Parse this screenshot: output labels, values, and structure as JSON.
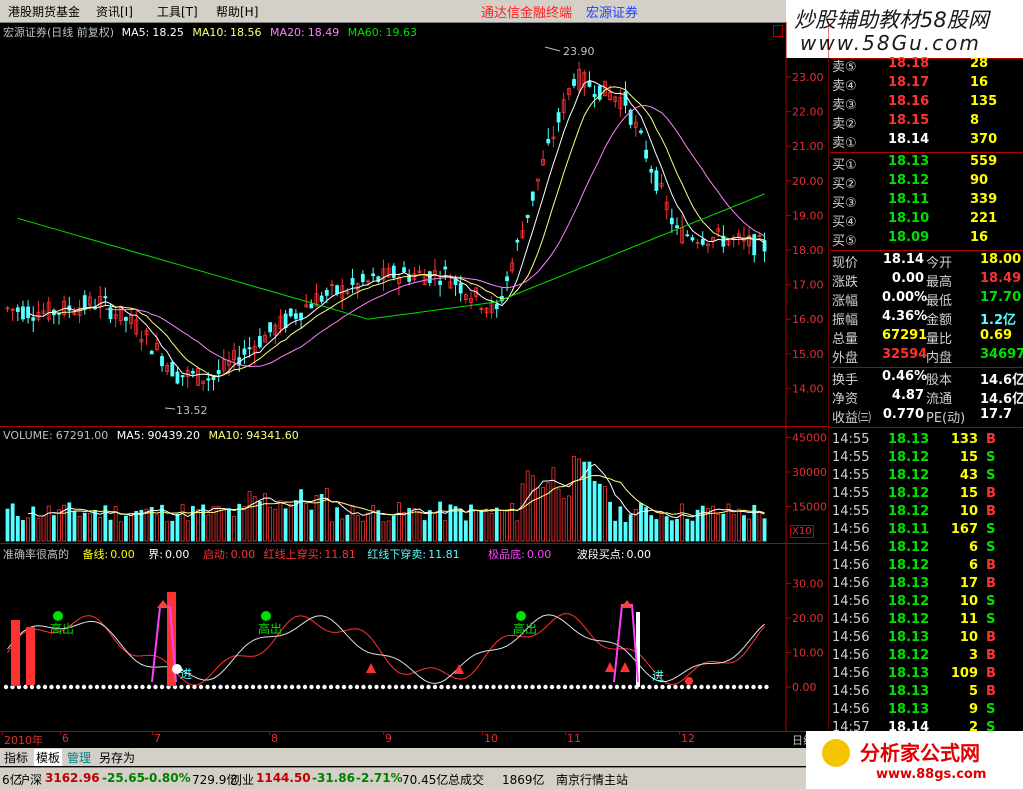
{
  "menu": {
    "items": [
      "港股期货基金",
      "资讯[I]",
      "工具[T]",
      "帮助[H]"
    ],
    "brand_red": "通达信金融终端",
    "brand_blue": "宏源证券"
  },
  "watermark": {
    "text": "炒股辅助教材58股网",
    "url": "www.58Gu.com"
  },
  "price_panel": {
    "title": "宏源证券(日线 前复权)",
    "ma5_label": "MA5:",
    "ma5": "18.25",
    "ma10_label": "MA10:",
    "ma10": "18.56",
    "ma20_label": "MA20:",
    "ma20": "18.49",
    "ma60_label": "MA60:",
    "ma60": "19.63",
    "y_ticks": [
      "23.00",
      "22.00",
      "21.00",
      "20.00",
      "19.00",
      "18.00",
      "17.00",
      "16.00",
      "15.00",
      "14.00"
    ],
    "high_marker": "23.90",
    "low_marker": "13.52"
  },
  "volume_panel": {
    "volume_label": "VOLUME:",
    "volume": "67291.00",
    "ma5_label": "MA5:",
    "ma5": "90439.20",
    "ma10_label": "MA10:",
    "ma10": "94341.60",
    "y_ticks": [
      "45000",
      "30000",
      "15000"
    ],
    "unit": "X10"
  },
  "indicator_panel": {
    "name": "准确率很高的",
    "beixian_label": "备线:",
    "beixian": "0.00",
    "jie_label": "界:",
    "jie": "0.00",
    "qidong_label": "启动:",
    "qidong": "0.00",
    "hongshang_label": "红线上穿买:",
    "hongshang": "11.81",
    "hongxia_label": "红线下穿卖:",
    "hongxia": "11.81",
    "jidi_label": "极品底:",
    "jidi": "0.00",
    "boduan_label": "波段买点:",
    "boduan": "0.00",
    "y_ticks": [
      "30.00",
      "20.00",
      "10.00",
      "0.00"
    ],
    "chu_label": "高出",
    "jin_label": "进"
  },
  "x_axis": {
    "labels": [
      "2010年",
      "6",
      "7",
      "8",
      "9",
      "10",
      "11",
      "12"
    ],
    "period": "日线"
  },
  "order_book": {
    "asks": [
      {
        "label": "卖⑤",
        "price": "18.18",
        "vol": "28"
      },
      {
        "label": "卖④",
        "price": "18.17",
        "vol": "16"
      },
      {
        "label": "卖③",
        "price": "18.16",
        "vol": "135"
      },
      {
        "label": "卖②",
        "price": "18.15",
        "vol": "8"
      },
      {
        "label": "卖①",
        "price": "18.14",
        "vol": "370"
      }
    ],
    "bids": [
      {
        "label": "买①",
        "price": "18.13",
        "vol": "559"
      },
      {
        "label": "买②",
        "price": "18.12",
        "vol": "90"
      },
      {
        "label": "买③",
        "price": "18.11",
        "vol": "339"
      },
      {
        "label": "买④",
        "price": "18.10",
        "vol": "221"
      },
      {
        "label": "买⑤",
        "price": "18.09",
        "vol": "16"
      }
    ]
  },
  "quote": [
    {
      "l1": "现价",
      "v1": "18.14",
      "l2": "今开",
      "v2": "18.00"
    },
    {
      "l1": "涨跌",
      "v1": "0.00",
      "l2": "最高",
      "v2": "18.49"
    },
    {
      "l1": "涨幅",
      "v1": "0.00%",
      "l2": "最低",
      "v2": "17.70"
    },
    {
      "l1": "振幅",
      "v1": "4.36%",
      "l2": "金额",
      "v2": "1.2亿"
    },
    {
      "l1": "总量",
      "v1": "67291",
      "l2": "量比",
      "v2": "0.69"
    },
    {
      "l1": "外盘",
      "v1": "32594",
      "l2": "内盘",
      "v2": "34697"
    },
    {
      "l1": "换手",
      "v1": "0.46%",
      "l2": "股本",
      "v2": "14.6亿"
    },
    {
      "l1": "净资",
      "v1": "4.87",
      "l2": "流通",
      "v2": "14.6亿"
    },
    {
      "l1": "收益㈢",
      "v1": "0.770",
      "l2": "PE(动)",
      "v2": "17.7"
    }
  ],
  "ticks": [
    {
      "t": "14:55",
      "p": "18.13",
      "v": "133",
      "s": "B"
    },
    {
      "t": "14:55",
      "p": "18.12",
      "v": "15",
      "s": "S"
    },
    {
      "t": "14:55",
      "p": "18.12",
      "v": "43",
      "s": "S"
    },
    {
      "t": "14:55",
      "p": "18.12",
      "v": "15",
      "s": "B"
    },
    {
      "t": "14:55",
      "p": "18.12",
      "v": "10",
      "s": "B"
    },
    {
      "t": "14:56",
      "p": "18.11",
      "v": "167",
      "s": "S"
    },
    {
      "t": "14:56",
      "p": "18.12",
      "v": "6",
      "s": "S"
    },
    {
      "t": "14:56",
      "p": "18.12",
      "v": "6",
      "s": "B"
    },
    {
      "t": "14:56",
      "p": "18.13",
      "v": "17",
      "s": "B"
    },
    {
      "t": "14:56",
      "p": "18.12",
      "v": "10",
      "s": "S"
    },
    {
      "t": "14:56",
      "p": "18.12",
      "v": "11",
      "s": "S"
    },
    {
      "t": "14:56",
      "p": "18.13",
      "v": "10",
      "s": "B"
    },
    {
      "t": "14:56",
      "p": "18.12",
      "v": "3",
      "s": "B"
    },
    {
      "t": "14:56",
      "p": "18.13",
      "v": "109",
      "s": "B"
    },
    {
      "t": "14:56",
      "p": "18.13",
      "v": "5",
      "s": "B"
    },
    {
      "t": "14:56",
      "p": "18.13",
      "v": "9",
      "s": "S"
    },
    {
      "t": "14:57",
      "p": "18.14",
      "v": "2",
      "s": "S"
    }
  ],
  "tabs": [
    "指标",
    "模板",
    "管理",
    "另存为"
  ],
  "status": {
    "s1": "6亿",
    "s2": "沪深",
    "s3": "3162.96",
    "s4": "-25.65",
    "s5": "-0.80%",
    "s6": "729.9亿",
    "s7": "创业",
    "s8": "1144.50",
    "s9": "-31.86",
    "s10": "-2.71%",
    "s11": "70.45亿",
    "s12": "总成交",
    "s13": "1869亿",
    "s14": "南京行情主站"
  },
  "logo2": {
    "text": "分析家公式网",
    "url": "www.88gs.com"
  },
  "colors": {
    "up": "#ff3232",
    "down": "#54ffff",
    "ma5": "#ffffff",
    "ma10": "#ffff80",
    "ma20": "#ff80ff",
    "ma60": "#00e000",
    "axis": "#b00000"
  }
}
